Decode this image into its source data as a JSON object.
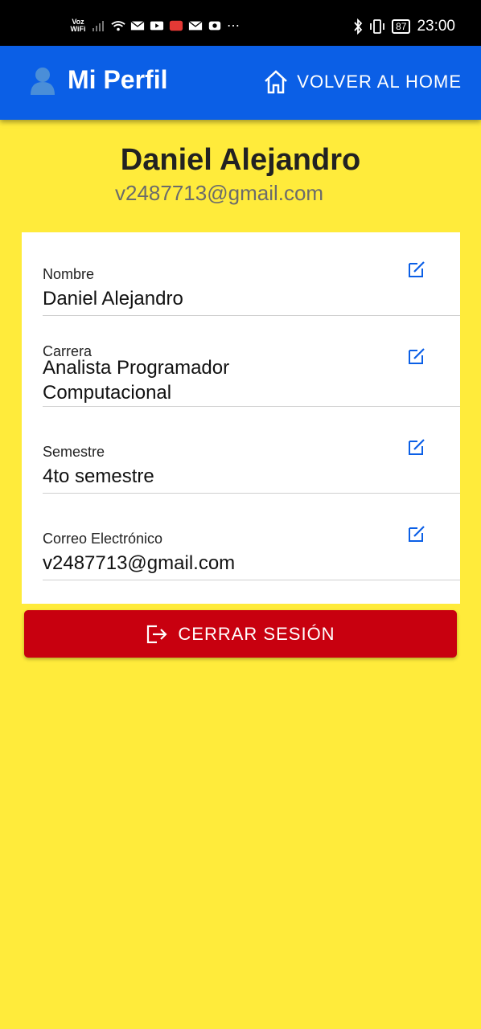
{
  "status_bar": {
    "carrier_label": "Voz WiFi",
    "battery": "87",
    "time": "23:00"
  },
  "app_bar": {
    "title": "Mi Perfil",
    "home_label": "VOLVER AL HOME"
  },
  "profile": {
    "name": "Daniel Alejandro",
    "email": "v2487713@gmail.com"
  },
  "fields": [
    {
      "label": "Nombre",
      "value": "Daniel Alejandro"
    },
    {
      "label": "Carrera",
      "value": "Analista Programador Computacional"
    },
    {
      "label": "Semestre",
      "value": "4to semestre"
    },
    {
      "label": "Correo Electrónico",
      "value": "v2487713@gmail.com"
    }
  ],
  "logout_label": "CERRAR SESIÓN",
  "colors": {
    "app_bar": "#0b5fe6",
    "background": "#ffeb3b",
    "logout": "#c8000f",
    "edit_icon": "#0b5fe6"
  }
}
